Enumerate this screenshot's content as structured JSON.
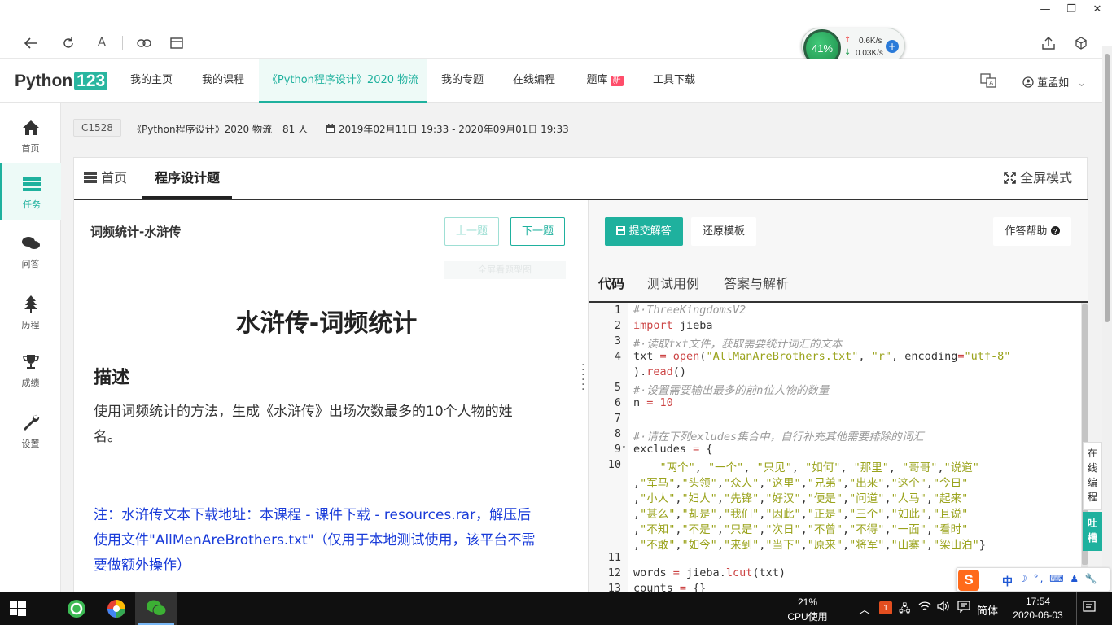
{
  "window": {
    "minimize": "—",
    "restore": "❐",
    "close": "✕"
  },
  "browser": {
    "back_icon": "arrow-left",
    "reload_icon": "reload",
    "reader_icon": "A",
    "link_icon": "link",
    "tab_icon": "window"
  },
  "speed_widget": {
    "cpu_percent": "41%",
    "upload": "0.6K/s",
    "download": "0.03K/s",
    "plus": "+"
  },
  "header": {
    "logo_text": "Python",
    "logo_badge": "123",
    "nav": [
      "我的主页",
      "我的课程",
      "《Python程序设计》2020 物流",
      "我的专题",
      "在线编程",
      "题库",
      "工具下载"
    ],
    "new_badge": "新",
    "user": "董孟如"
  },
  "sidebar": [
    {
      "label": "首页",
      "icon": "⌂"
    },
    {
      "label": "任务",
      "icon": "☰"
    },
    {
      "label": "问答",
      "icon": "💬"
    },
    {
      "label": "历程",
      "icon": "🌲"
    },
    {
      "label": "成绩",
      "icon": "🏆"
    },
    {
      "label": "设置",
      "icon": "🔧"
    }
  ],
  "course": {
    "code": "C1528",
    "name": "《Python程序设计》2020 物流",
    "students": "81 人",
    "period": "2019年02月11日 19:33 - 2020年09月01日 19:33"
  },
  "panel": {
    "tab_home": "首页",
    "tab_active": "程序设计题",
    "fullscreen": "全屏模式"
  },
  "problem": {
    "short_title": "词频统计-水浒传",
    "prev": "上一题",
    "next": "下一题",
    "faint_text": "全屏看题型图",
    "title": "水浒传-词频统计",
    "desc_heading": "描述",
    "desc_line1": "使用词频统计的方法，生成《水浒传》出场次数最多的10个人物的姓",
    "desc_line2": "名。",
    "note_line1": "注：水浒传文本下载地址：本课程 - 课件下载 - resources.rar，解压后",
    "note_line2": "使用文件\"AllMenAreBrothers.txt\"（仅用于本地测试使用，该平台不需",
    "note_line3": "要做额外操作）"
  },
  "editor": {
    "submit": "提交解答",
    "reset": "还原模板",
    "help": "作答帮助",
    "tabs": [
      "代码",
      "测试用例",
      "答案与解析"
    ]
  },
  "code_lines": [
    {
      "n": "1",
      "html": "<span class='cm'>#·ThreeKingdomsV2</span>"
    },
    {
      "n": "2",
      "html": "<span class='kw'>import</span> jieba"
    },
    {
      "n": "3",
      "html": "<span class='cm'>#·读取txt文件，获取需要统计词汇的文本</span>"
    },
    {
      "n": "4",
      "html": "txt <span class='kw'>=</span> <span class='fn'>open</span>(<span class='str'>\"AllManAreBrothers.txt\"</span>, <span class='str'>\"r\"</span>, encoding<span class='kw'>=</span><span class='str'>\"utf-8\"</span>"
    },
    {
      "n": "",
      "html": ").<span class='fn'>read</span>()"
    },
    {
      "n": "5",
      "html": "<span class='cm'>#·设置需要输出最多的前n位人物的数量</span>"
    },
    {
      "n": "6",
      "html": "n <span class='kw'>=</span> <span class='num'>10</span>"
    },
    {
      "n": "7",
      "html": ""
    },
    {
      "n": "8",
      "html": "<span class='cm'>#·请在下列exludes集合中，自行补充其他需要排除的词汇</span>"
    },
    {
      "n": "9",
      "html": "excludes <span class='kw'>=</span> {"
    },
    {
      "n": "10",
      "html": "    <span class='str'>\"两个\"</span>, <span class='str'>\"一个\"</span>, <span class='str'>\"只见\"</span>, <span class='str'>\"如何\"</span>, <span class='str'>\"那里\"</span>, <span class='str'>\"哥哥\"</span>,<span class='str'>\"说道\"</span>"
    },
    {
      "n": "",
      "html": ",<span class='str'>\"军马\"</span>,<span class='str'>\"头领\"</span>,<span class='str'>\"众人\"</span>,<span class='str'>\"这里\"</span>,<span class='str'>\"兄弟\"</span>,<span class='str'>\"出来\"</span>,<span class='str'>\"这个\"</span>,<span class='str'>\"今日\"</span>"
    },
    {
      "n": "",
      "html": ",<span class='str'>\"小人\"</span>,<span class='str'>\"妇人\"</span>,<span class='str'>\"先锋\"</span>,<span class='str'>\"好汉\"</span>,<span class='str'>\"便是\"</span>,<span class='str'>\"问道\"</span>,<span class='str'>\"人马\"</span>,<span class='str'>\"起来\"</span>"
    },
    {
      "n": "",
      "html": ",<span class='str'>\"甚么\"</span>,<span class='str'>\"却是\"</span>,<span class='str'>\"我们\"</span>,<span class='str'>\"因此\"</span>,<span class='str'>\"正是\"</span>,<span class='str'>\"三个\"</span>,<span class='str'>\"如此\"</span>,<span class='str'>\"且说\"</span>"
    },
    {
      "n": "",
      "html": ",<span class='str'>\"不知\"</span>,<span class='str'>\"不是\"</span>,<span class='str'>\"只是\"</span>,<span class='str'>\"次日\"</span>,<span class='str'>\"不曾\"</span>,<span class='str'>\"不得\"</span>,<span class='str'>\"一面\"</span>,<span class='str'>\"看时\"</span>"
    },
    {
      "n": "",
      "html": ",<span class='str'>\"不敢\"</span>,<span class='str'>\"如今\"</span>,<span class='str'>\"来到\"</span>,<span class='str'>\"当下\"</span>,<span class='str'>\"原来\"</span>,<span class='str'>\"将军\"</span>,<span class='str'>\"山寨\"</span>,<span class='str'>\"梁山泊\"</span>}"
    },
    {
      "n": "11",
      "html": ""
    },
    {
      "n": "12",
      "html": "words <span class='kw'>=</span> jieba.<span class='fn'>lcut</span>(txt)"
    },
    {
      "n": "13",
      "html": "counts <span class='kw'>=</span> {}"
    }
  ],
  "float": {
    "online_chars": [
      "在",
      "线",
      "编",
      "程"
    ],
    "tucao_chars": [
      "吐",
      "槽"
    ]
  },
  "ime": {
    "lang": "中",
    "items": "☽ °, ⌨ ♟ 🔧"
  },
  "taskbar": {
    "cpu_percent": "21%",
    "cpu_label": "CPU使用",
    "lang": "简体",
    "time": "17:54",
    "date": "2020-06-03",
    "calendar_day": "1"
  }
}
